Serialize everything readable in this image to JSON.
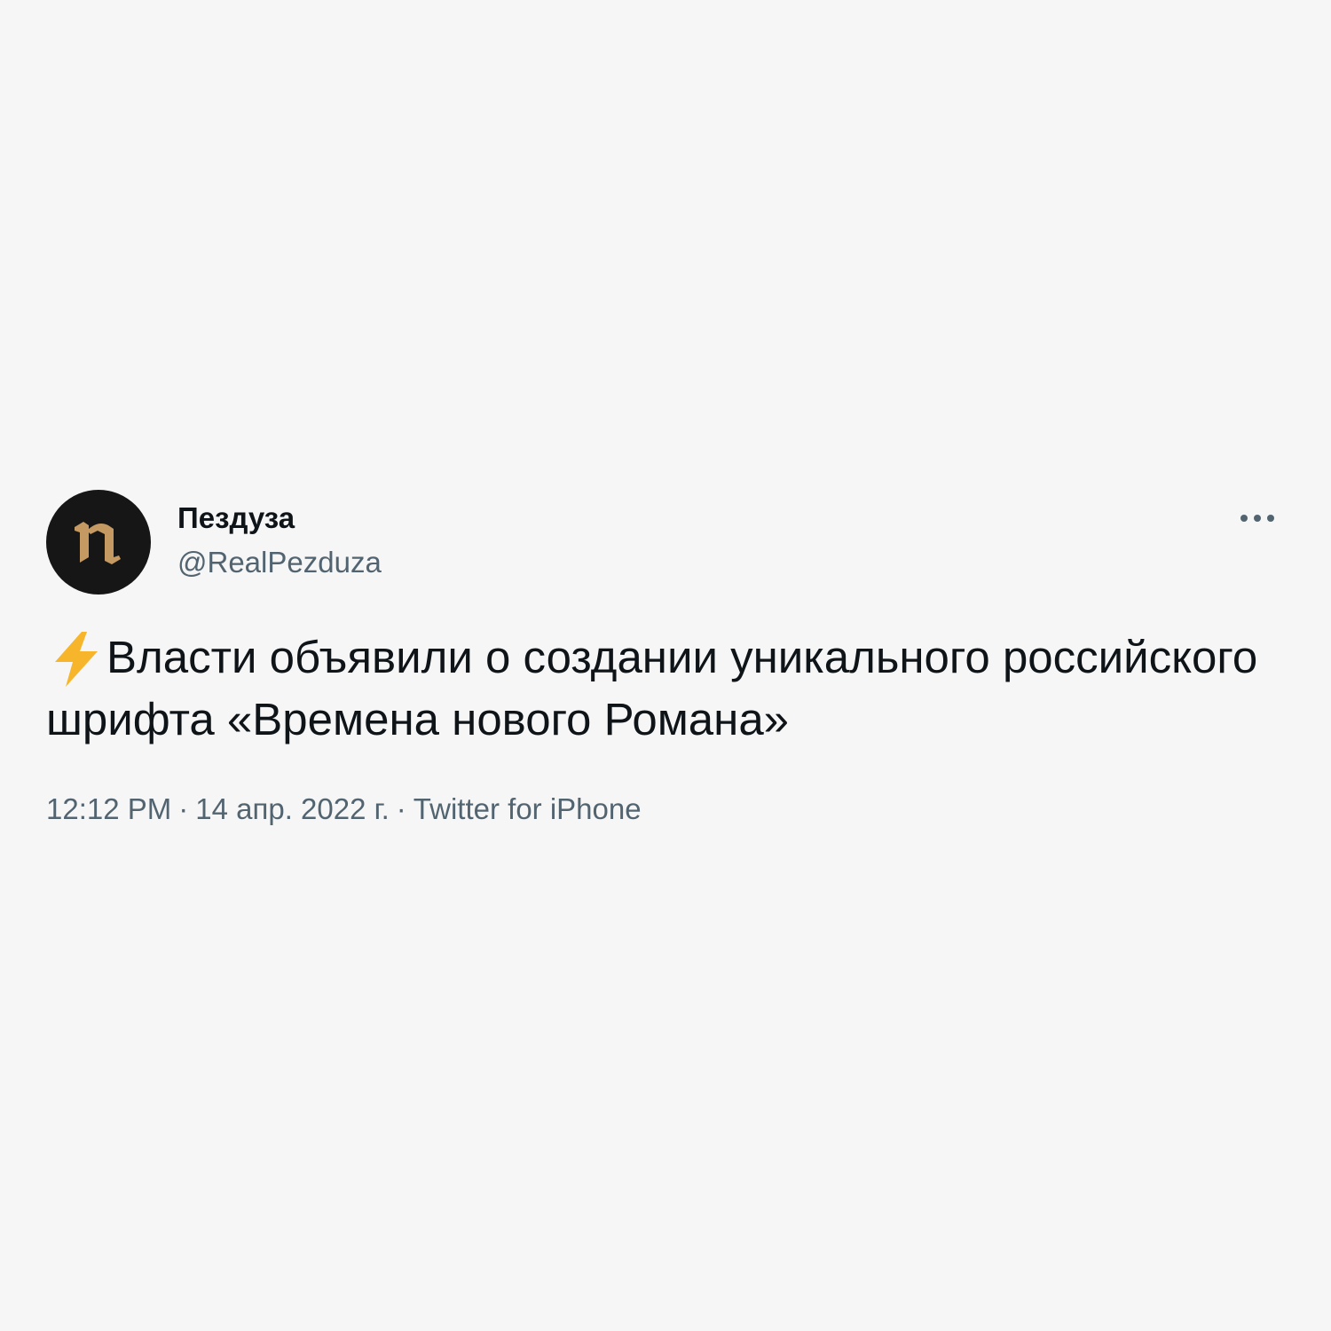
{
  "tweet": {
    "author": {
      "display_name": "Пездуза",
      "handle": "@RealPezduza",
      "avatar_icon": "meduza-logo-icon"
    },
    "more_icon": "more-dots-icon",
    "text": {
      "emoji_icon": "high-voltage-icon",
      "body": "Власти объявили о создании уникального российского шрифта «Времена нового Романа»"
    },
    "meta": {
      "time": "12:12 PM",
      "separator": "·",
      "date": "14 апр. 2022 г.",
      "source": "Twitter for iPhone"
    }
  },
  "colors": {
    "background": "#f6f6f6",
    "text_primary": "#0f1419",
    "text_secondary": "#536471",
    "avatar_bg": "#161616",
    "logo_gold": "#c59a62",
    "bolt_yellow": "#f7b52b"
  }
}
